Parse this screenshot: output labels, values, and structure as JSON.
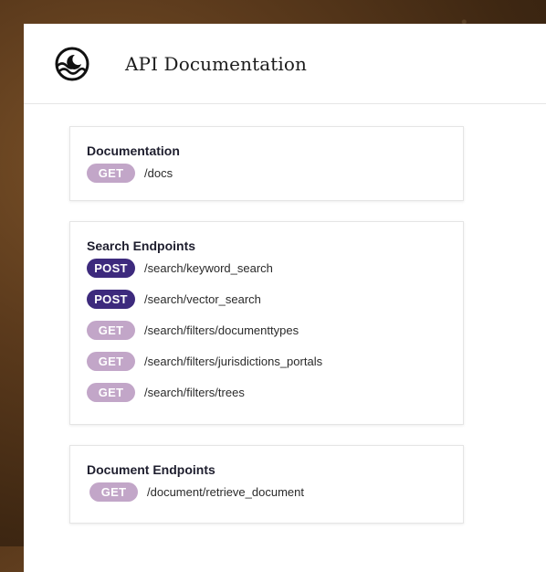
{
  "header": {
    "title": "API Documentation",
    "logo_icon": "waves-moon-logo-icon"
  },
  "colors": {
    "get_badge": "#c2a6c8",
    "post_badge": "#3d2a7d"
  },
  "sections": [
    {
      "title": "Documentation",
      "endpoints": [
        {
          "method": "GET",
          "path": "/docs"
        }
      ]
    },
    {
      "title": "Search Endpoints",
      "endpoints": [
        {
          "method": "POST",
          "path": "/search/keyword_search"
        },
        {
          "method": "POST",
          "path": "/search/vector_search"
        },
        {
          "method": "GET",
          "path": "/search/filters/documenttypes"
        },
        {
          "method": "GET",
          "path": "/search/filters/jurisdictions_portals"
        },
        {
          "method": "GET",
          "path": "/search/filters/trees"
        }
      ]
    },
    {
      "title": "Document Endpoints",
      "endpoints": [
        {
          "method": "GET",
          "path": "/document/retrieve_document"
        }
      ]
    }
  ]
}
